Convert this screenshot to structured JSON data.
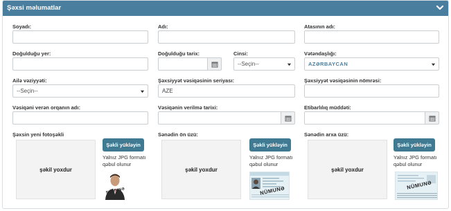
{
  "panel": {
    "title": "Şəxsi məlumatlar",
    "header_color": "#4a7e9e"
  },
  "fields": {
    "surname": {
      "label": "Soyadı",
      "colon": ":",
      "value": ""
    },
    "name": {
      "label": "Adı",
      "colon": ":",
      "value": ""
    },
    "patronymic": {
      "label": "Atasının adı",
      "colon": ":",
      "value": ""
    },
    "birthplace": {
      "label": "Doğulduğu yer",
      "colon": ":",
      "value": ""
    },
    "birthdate": {
      "label": "Doğulduğu tarix",
      "colon": ":",
      "value": ""
    },
    "gender": {
      "label": "Cinsi",
      "colon": ":",
      "value": "--Seçin--"
    },
    "citizenship": {
      "label": "Vətəndaşlığı",
      "colon": ":",
      "value": "AZƏRBAYCAN"
    },
    "marital_status": {
      "label": "Ailə vəziyyəti",
      "colon": ":",
      "value": "--Seçin--"
    },
    "id_series": {
      "label": "Şəxsiyyət vəsiqəsinin seriyası",
      "colon": ":",
      "value": "AZE"
    },
    "id_number": {
      "label": "Şəxsiyyət vəsiqəsinin nömrəsi",
      "colon": ":",
      "value": ""
    },
    "issuing_authority": {
      "label": "Vəsiqəni verən orqanın adı",
      "colon": ":",
      "value": ""
    },
    "issue_date": {
      "label": "Vəsiqənin verilmə tarixi",
      "colon": ":",
      "value": ""
    },
    "validity": {
      "label": "Etibarlılıq müddəti",
      "colon": ":",
      "value": ""
    }
  },
  "uploads": [
    {
      "label": "Şəxsin yeni fotoşəkli",
      "empty_text": "şəkil yoxdur",
      "button": "Şəkli yükləyin",
      "note": "Yalnız JPG formatı qəbul olunur",
      "stamp": "NÜMUNƏ"
    },
    {
      "label": "Sənədin ön üzü:",
      "empty_text": "şəkil yoxdur",
      "button": "Şəkli yükləyin",
      "note": "Yalnız JPG formatı qəbul olunur",
      "stamp": "NÜMUNƏ"
    },
    {
      "label": "Sənədin arxa üzü:",
      "empty_text": "şəkil yoxdur",
      "button": "Şəkli yükləyin",
      "note": "Yalnız JPG formatı qəbul olunur",
      "stamp": "NÜMUNƏ"
    }
  ]
}
